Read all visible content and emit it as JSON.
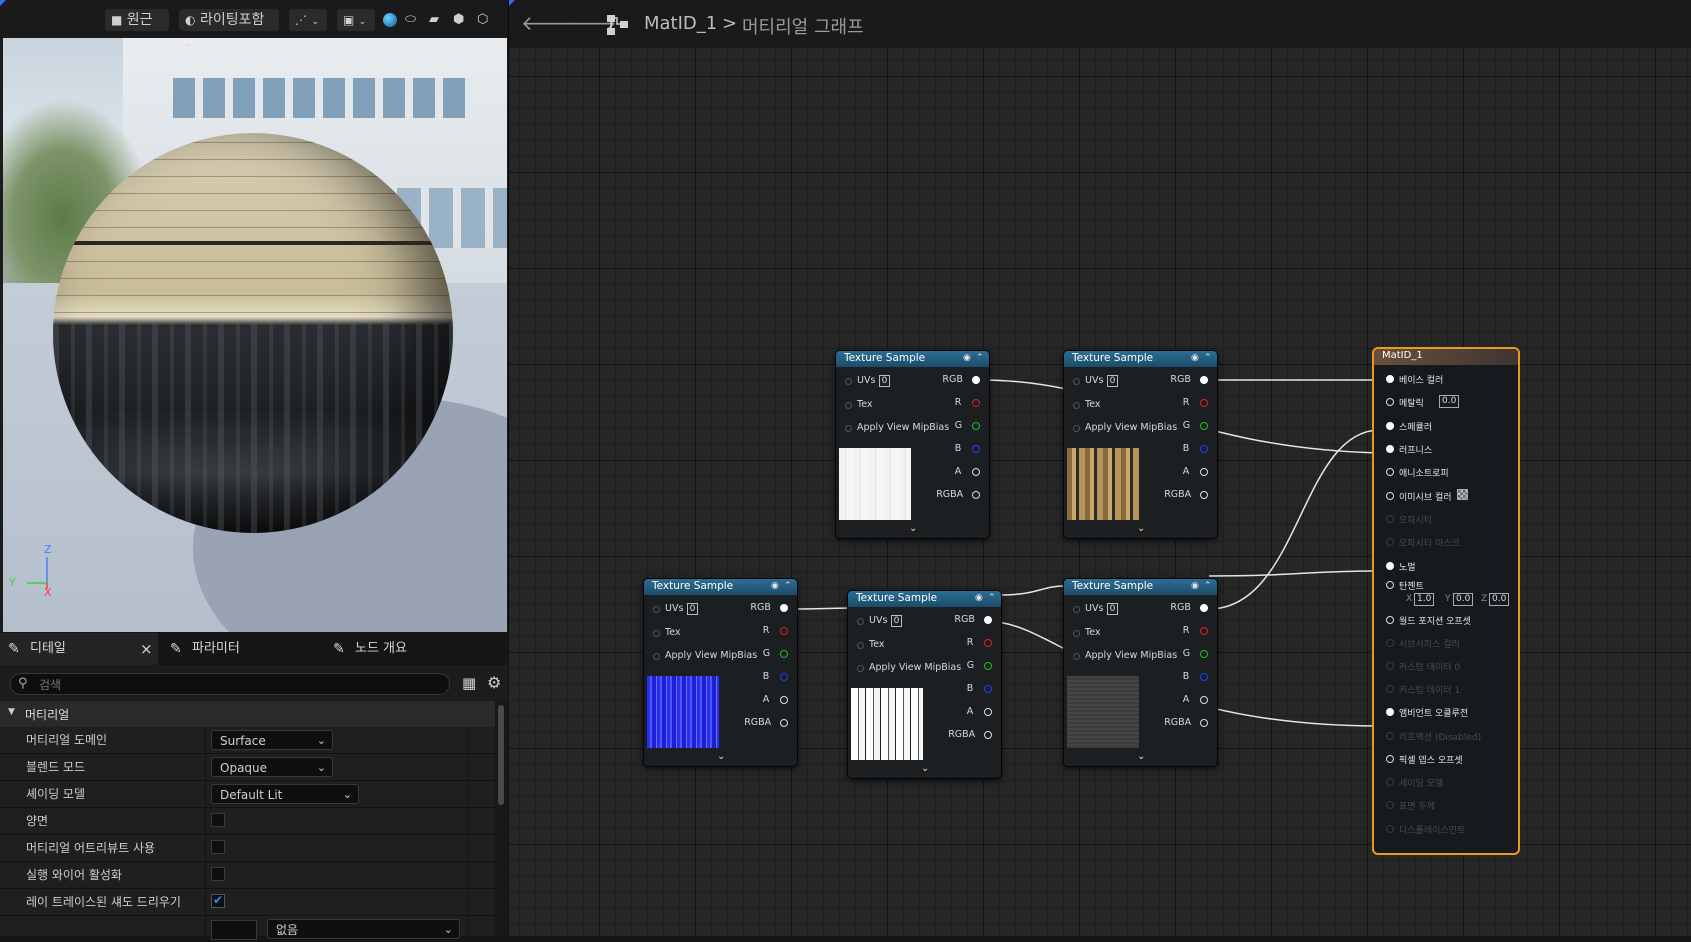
{
  "viewport": {
    "toolbar": {
      "perspective_label": "원근",
      "lighting_label": "라이팅포함"
    },
    "axes": {
      "z": "Z",
      "y": "Y",
      "x": "X"
    }
  },
  "details_panel": {
    "tabs": [
      {
        "label": "디테일"
      },
      {
        "label": "파라미터"
      },
      {
        "label": "노드 개요"
      }
    ],
    "close_glyph": "×",
    "search_placeholder": "검색",
    "section_title": "머티리얼",
    "rows": [
      {
        "label": "머티리얼 도메인",
        "value": "Surface"
      },
      {
        "label": "블렌드 모드",
        "value": "Opaque"
      },
      {
        "label": "셰이딩 모델",
        "value": "Default Lit"
      },
      {
        "label": "양면",
        "checked": false
      },
      {
        "label": "머티리얼 어트리뷰트 사용",
        "checked": false
      },
      {
        "label": "실행 와이어 활성화",
        "checked": false
      },
      {
        "label": "레이 트레이스된 섀도 드리우기",
        "checked": true
      }
    ],
    "last_row_value": "없음"
  },
  "graph_header": {
    "material_name": "MatID_1",
    "separator": ">",
    "graph_title": "머티리얼 그래프"
  },
  "texture_node": {
    "title": "Texture Sample",
    "inputs": [
      "UVs",
      "Tex",
      "Apply View MipBias"
    ],
    "uv_value": "0",
    "outputs": [
      "RGB",
      "R",
      "G",
      "B",
      "A",
      "RGBA"
    ],
    "output_colors": {
      "R": "#e02020",
      "G": "#20c020",
      "B": "#2040ff"
    }
  },
  "result_node": {
    "title": "MatID_1",
    "pins": [
      {
        "label": "베이스 컬러",
        "state": "on"
      },
      {
        "label": "메탈릭",
        "state": "open",
        "value": "0.0"
      },
      {
        "label": "스페큘러",
        "state": "on"
      },
      {
        "label": "러프니스",
        "state": "on"
      },
      {
        "label": "애니소트로피",
        "state": "open"
      },
      {
        "label": "이미시브 컬러",
        "state": "open"
      },
      {
        "label": "오파시티",
        "state": "off"
      },
      {
        "label": "오파시티 마스크",
        "state": "off"
      },
      {
        "label": "노멀",
        "state": "on"
      },
      {
        "label": "탄젠트",
        "state": "open",
        "x": "1.0",
        "y": "0.0",
        "z": "0.0"
      },
      {
        "label": "월드 포지션 오프셋",
        "state": "open"
      },
      {
        "label": "서브서피스 컬러",
        "state": "off"
      },
      {
        "label": "커스텀 데이터 0",
        "state": "off"
      },
      {
        "label": "커스텀 데이터 1",
        "state": "off"
      },
      {
        "label": "앰비언트 오클루전",
        "state": "on"
      },
      {
        "label": "리프랙션 (Disabled)",
        "state": "off"
      },
      {
        "label": "픽셀 뎁스 오프셋",
        "state": "open"
      },
      {
        "label": "셰이딩 모델",
        "state": "off"
      },
      {
        "label": "표면 두께",
        "state": "off"
      },
      {
        "label": "디스플레이스먼트",
        "state": "off"
      }
    ],
    "tangent_axis": {
      "x": "X",
      "y": "Y",
      "z": "Z"
    }
  },
  "colors": {
    "accent_selected": "#e99a1e",
    "node_header": "#2d6e94",
    "check_blue": "#2f8ff5"
  }
}
